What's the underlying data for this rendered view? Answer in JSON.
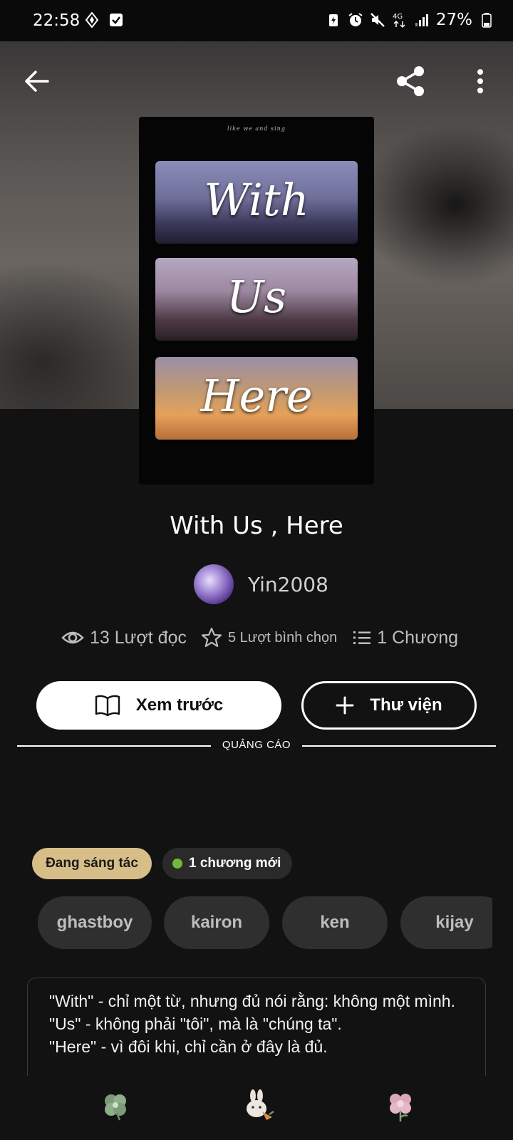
{
  "status_bar": {
    "time": "22:58",
    "battery": "27%"
  },
  "book": {
    "title": "With Us , Here",
    "author": "Yin2008",
    "cover_words": [
      "With",
      "Us",
      "Here"
    ],
    "cover_small_text": "like we and sing"
  },
  "stats": {
    "reads": "13 Lượt đọc",
    "votes": "5 Lượt bình chọn",
    "chapters": "1 Chương"
  },
  "actions": {
    "preview_label": "Xem trước",
    "library_label": "Thư viện"
  },
  "ad_label": "QUẢNG CÁO",
  "badges": {
    "status": "Đang sáng tác",
    "new_chapters": "1 chương mới"
  },
  "tags": [
    "ghastboy",
    "kairon",
    "ken",
    "kijay"
  ],
  "description": [
    "\"With\" - chỉ một từ, nhưng đủ nói rằng: không một mình.",
    "\"Us\" - không phải \"tôi\", mà là \"chúng ta\".",
    "\"Here\" - vì đôi khi, chỉ cần ở đây là đủ."
  ],
  "colors": {
    "background": "#121212",
    "status_badge": "#d7bd87",
    "new_dot": "#74b83a",
    "tag_bg": "#2f2f2f"
  }
}
